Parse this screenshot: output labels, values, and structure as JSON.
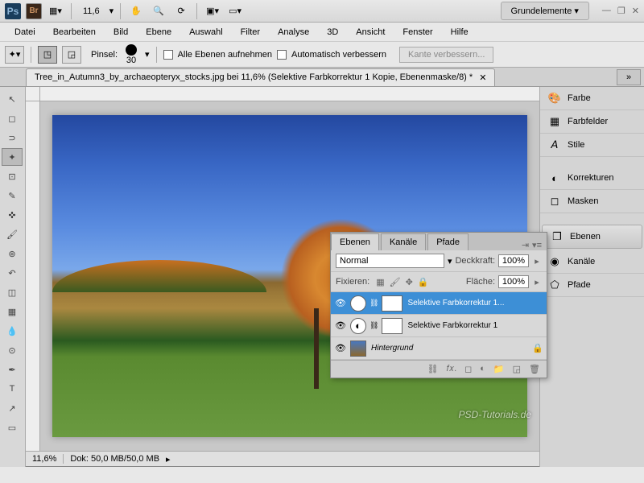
{
  "topbar": {
    "zoom": "11,6",
    "workspace": "Grundelemente ▾"
  },
  "menu": [
    "Datei",
    "Bearbeiten",
    "Bild",
    "Ebene",
    "Auswahl",
    "Filter",
    "Analyse",
    "3D",
    "Ansicht",
    "Fenster",
    "Hilfe"
  ],
  "optbar": {
    "pinsel_label": "Pinsel:",
    "pinsel_size": "30",
    "cb1": "Alle Ebenen aufnehmen",
    "cb2": "Automatisch verbessern",
    "kante": "Kante verbessern..."
  },
  "doc_tab": "Tree_in_Autumn3_by_archaeopteryx_stocks.jpg bei 11,6% (Selektive Farbkorrektur 1 Kopie, Ebenenmaske/8) *",
  "right_panels": [
    "Farbe",
    "Farbfelder",
    "Stile",
    "Korrekturen",
    "Masken",
    "Ebenen",
    "Kanäle",
    "Pfade"
  ],
  "layers_panel": {
    "tabs": [
      "Ebenen",
      "Kanäle",
      "Pfade"
    ],
    "blend": "Normal",
    "opacity_label": "Deckkraft:",
    "opacity": "100%",
    "fix_label": "Fixieren:",
    "fill_label": "Fläche:",
    "fill": "100%",
    "layers": [
      {
        "name": "Selektive Farbkorrektur 1..."
      },
      {
        "name": "Selektive Farbkorrektur 1"
      },
      {
        "name": "Hintergrund"
      }
    ]
  },
  "status": {
    "zoom": "11,6%",
    "dok": "Dok: 50,0 MB/50,0 MB"
  },
  "watermark": "PSD-Tutorials.de"
}
